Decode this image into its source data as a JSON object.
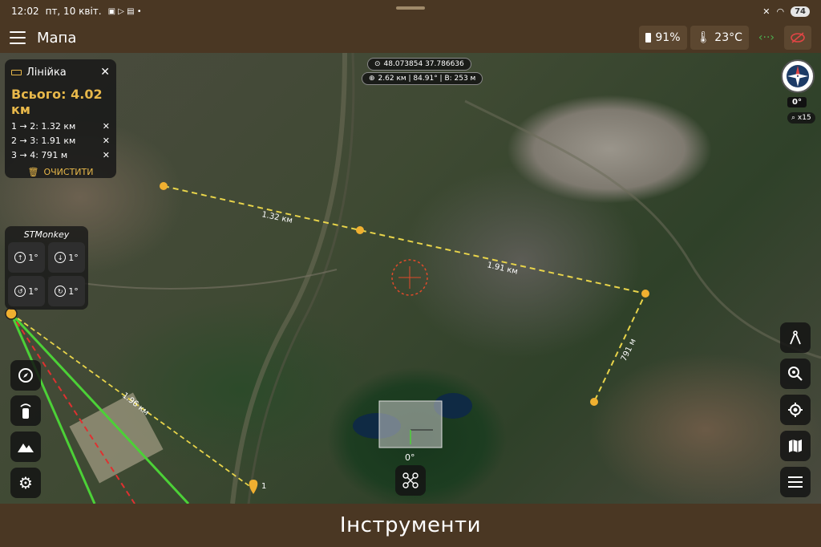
{
  "status_bar": {
    "time": "12:02",
    "date": "пт, 10 квіт.",
    "battery": "74"
  },
  "app_bar": {
    "title": "Мапа",
    "battery_percent": "91%",
    "temperature": "23°C"
  },
  "map": {
    "coordinates": "48.073854 37.786636",
    "measure": "2.62 км | 84.91° | В: 253 м",
    "segment_labels": [
      "1.32 км",
      "1.91 км",
      "791 м",
      "1.96 км"
    ],
    "point_label": "1",
    "drone_heading": "0°"
  },
  "ruler": {
    "title": "Лінійка",
    "total": "Всього: 4.02 км",
    "segments": [
      "1 → 2: 1.32 км",
      "2 → 3: 1.91 км",
      "3 → 4: 791 м"
    ],
    "clear_label": "ОЧИСТИТИ"
  },
  "stmonkey": {
    "title": "STMonkey",
    "buttons": [
      "1°",
      "1°",
      "1°",
      "1°"
    ]
  },
  "compass": {
    "heading": "0°",
    "zoom": "x15"
  },
  "bottom_bar": {
    "title": "Інструменти"
  },
  "colors": {
    "accent": "#e8b84a",
    "bar": "#4a3723",
    "green_line": "#4cd137",
    "red_line": "#e03030"
  }
}
